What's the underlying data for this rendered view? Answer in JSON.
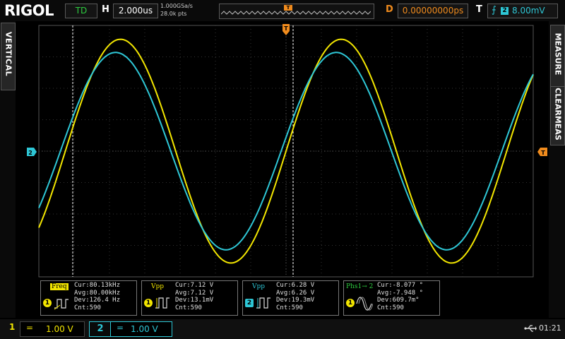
{
  "topbar": {
    "brand": "RIGOL",
    "run_state": "TD",
    "horizontal_label": "H",
    "timebase": "2.000us",
    "sample_rate": "1.000GSa/s",
    "memory_depth": "28.0k pts",
    "trigger_marker": "T",
    "delay_label": "D",
    "delay_value": "0.00000000ps",
    "trigger_label": "T",
    "trigger_edge_icon": "rising-edge-icon",
    "trigger_source": "2",
    "trigger_level": "8.00mV"
  },
  "left_menu": {
    "tab": "VERTICAL"
  },
  "right_menu": {
    "tab1": "MEASURE",
    "tab2": "CLEARMEAS"
  },
  "markers": {
    "ch2_ground": "2",
    "trigger_level_marker": "T",
    "trigger_pos_marker": "T"
  },
  "colors": {
    "ch1": "#f3e600",
    "ch2": "#2ec7d6",
    "trigger": "#f08b1d",
    "phase": "#2ecc40"
  },
  "waveforms": {
    "period_us": 12.5,
    "ch1": {
      "amplitude_div": 3.56,
      "phase_deg": 0
    },
    "ch2": {
      "amplitude_div": 3.14,
      "phase_deg": 8
    }
  },
  "measurements": [
    {
      "name": "Freq",
      "channel": "1",
      "glyph": "frequency-icon",
      "cur": "Cur:80.13kHz",
      "avg": "Avg:80.00kHz",
      "dev": "Dev:126.4 Hz",
      "cnt": "Cnt:590"
    },
    {
      "name": "Vpp",
      "channel": "1",
      "glyph": "vpp-icon",
      "cur": "Cur:7.12 V",
      "avg": "Avg:7.12 V",
      "dev": "Dev:13.1mV",
      "cnt": "Cnt:590"
    },
    {
      "name": "Vpp",
      "channel": "2",
      "glyph": "vpp-icon",
      "cur": "Cur:6.28 V",
      "avg": "Avg:6.26 V",
      "dev": "Dev:19.3mV",
      "cnt": "Cnt:590"
    },
    {
      "name": "Phs1→ 2",
      "channel": "1",
      "glyph": "phase-icon",
      "cur": "Cur:-8.077 °",
      "avg": "Avg:-7.948 °",
      "dev": "Dev:609.7m°",
      "cnt": "Cnt:590"
    }
  ],
  "bottombar": {
    "ch1": {
      "number": "1",
      "coupling": "=",
      "scale": "1.00 V"
    },
    "ch2": {
      "number": "2",
      "coupling": "=",
      "scale": "1.00 V"
    },
    "usb_icon": "usb-icon",
    "clock": "01:21"
  }
}
